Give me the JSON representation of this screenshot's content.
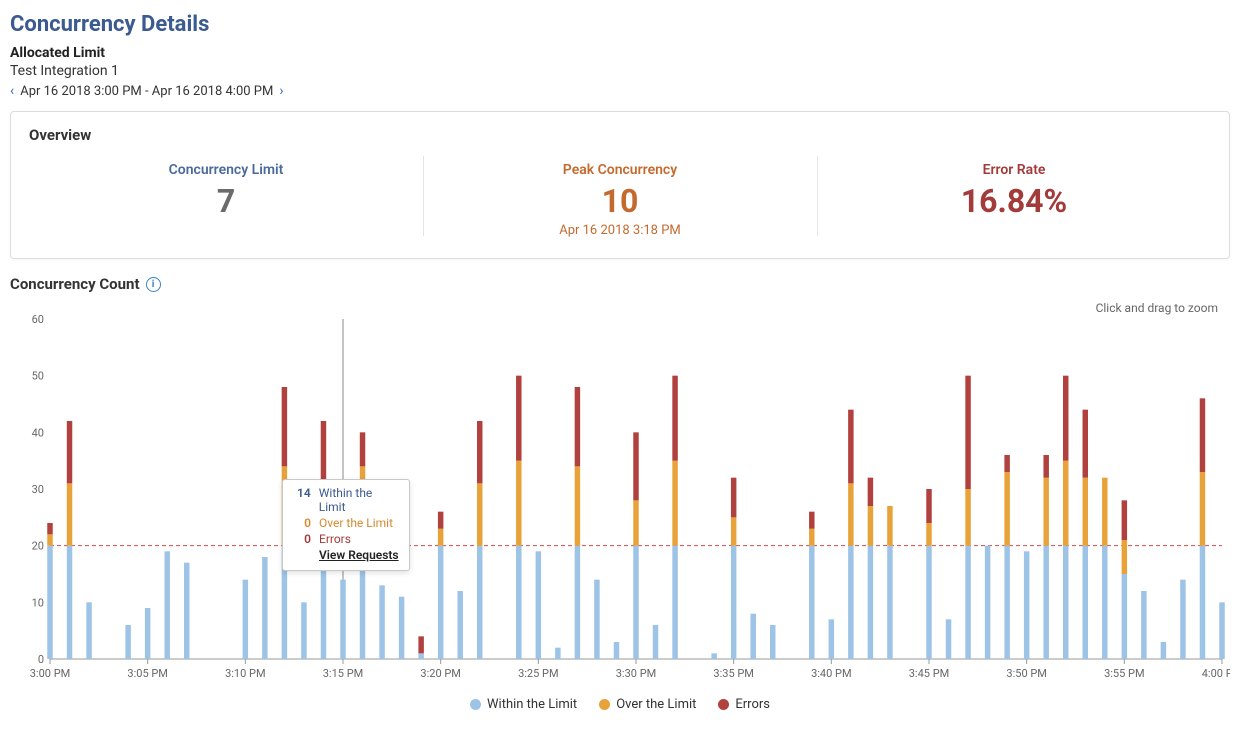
{
  "header": {
    "page_title": "Concurrency Details",
    "allocated_limit_label": "Allocated Limit",
    "integration_name": "Test Integration 1",
    "date_range": "Apr 16 2018 3:00 PM - Apr 16 2018 4:00 PM"
  },
  "overview": {
    "title": "Overview",
    "concurrency_limit_label": "Concurrency Limit",
    "concurrency_limit_value": "7",
    "peak_label": "Peak Concurrency",
    "peak_value": "10",
    "peak_time": "Apr 16 2018 3:18 PM",
    "error_label": "Error Rate",
    "error_value": "16.84%"
  },
  "section": {
    "title": "Concurrency Count",
    "zoom_hint": "Click and drag to zoom"
  },
  "tooltip": {
    "within_num": "14",
    "within_label": "Within the Limit",
    "over_num": "0",
    "over_label": "Over the Limit",
    "err_num": "0",
    "err_label": "Errors",
    "link": "View Requests"
  },
  "legend": {
    "within": "Within the Limit",
    "over": "Over the Limit",
    "errors": "Errors"
  },
  "colors": {
    "within": "#9dc3e6",
    "over": "#e8a23a",
    "errors": "#b0413e",
    "limit_line": "#d94a4a"
  },
  "chart_data": {
    "type": "bar",
    "stacked": true,
    "ylabel": "",
    "xlabel": "",
    "ylim": [
      0,
      60
    ],
    "yticks": [
      0,
      10,
      20,
      30,
      40,
      50,
      60
    ],
    "limit_line_value": 20,
    "xtick_labels": [
      "3:00 PM",
      "3:05 PM",
      "3:10 PM",
      "3:15 PM",
      "3:20 PM",
      "3:25 PM",
      "3:30 PM",
      "3:35 PM",
      "3:40 PM",
      "3:45 PM",
      "3:50 PM",
      "3:55 PM",
      "4:00 PM"
    ],
    "categories": [
      "3:00",
      "3:01",
      "3:02",
      "3:03",
      "3:04",
      "3:05",
      "3:06",
      "3:07",
      "3:08",
      "3:09",
      "3:10",
      "3:11",
      "3:12",
      "3:13",
      "3:14",
      "3:15",
      "3:16",
      "3:17",
      "3:18",
      "3:19",
      "3:20",
      "3:21",
      "3:22",
      "3:23",
      "3:24",
      "3:25",
      "3:26",
      "3:27",
      "3:28",
      "3:29",
      "3:30",
      "3:31",
      "3:32",
      "3:33",
      "3:34",
      "3:35",
      "3:36",
      "3:37",
      "3:38",
      "3:39",
      "3:40",
      "3:41",
      "3:42",
      "3:43",
      "3:44",
      "3:45",
      "3:46",
      "3:47",
      "3:48",
      "3:49",
      "3:50",
      "3:51",
      "3:52",
      "3:53",
      "3:54",
      "3:55",
      "3:56",
      "3:57",
      "3:58",
      "3:59",
      "4:00"
    ],
    "series": [
      {
        "name": "Within the Limit",
        "values": [
          20,
          20,
          10,
          0,
          6,
          9,
          19,
          17,
          0,
          0,
          14,
          18,
          20,
          10,
          20,
          14,
          20,
          13,
          11,
          1,
          20,
          12,
          20,
          0,
          20,
          19,
          2,
          20,
          14,
          3,
          20,
          6,
          20,
          0,
          1,
          20,
          8,
          6,
          0,
          20,
          7,
          20,
          20,
          20,
          0,
          20,
          7,
          20,
          20,
          20,
          19,
          20,
          20,
          20,
          20,
          15,
          12,
          3,
          14,
          20,
          10
        ]
      },
      {
        "name": "Over the Limit",
        "values": [
          2,
          11,
          0,
          0,
          0,
          0,
          0,
          0,
          0,
          0,
          0,
          0,
          14,
          0,
          10,
          0,
          14,
          0,
          0,
          0,
          3,
          0,
          11,
          0,
          15,
          0,
          0,
          14,
          0,
          0,
          8,
          0,
          15,
          0,
          0,
          5,
          0,
          0,
          0,
          3,
          0,
          11,
          7,
          7,
          0,
          4,
          0,
          10,
          0,
          13,
          0,
          12,
          15,
          12,
          12,
          6,
          0,
          0,
          0,
          13,
          0
        ]
      },
      {
        "name": "Errors",
        "values": [
          2,
          11,
          0,
          0,
          0,
          0,
          0,
          0,
          0,
          0,
          0,
          0,
          14,
          0,
          12,
          0,
          6,
          0,
          0,
          3,
          3,
          0,
          11,
          0,
          15,
          0,
          0,
          14,
          0,
          0,
          12,
          0,
          15,
          0,
          0,
          7,
          0,
          0,
          0,
          3,
          0,
          13,
          5,
          0,
          0,
          6,
          0,
          20,
          0,
          3,
          0,
          4,
          15,
          12,
          0,
          7,
          0,
          0,
          0,
          13,
          0
        ]
      }
    ],
    "hover_index": 15
  }
}
